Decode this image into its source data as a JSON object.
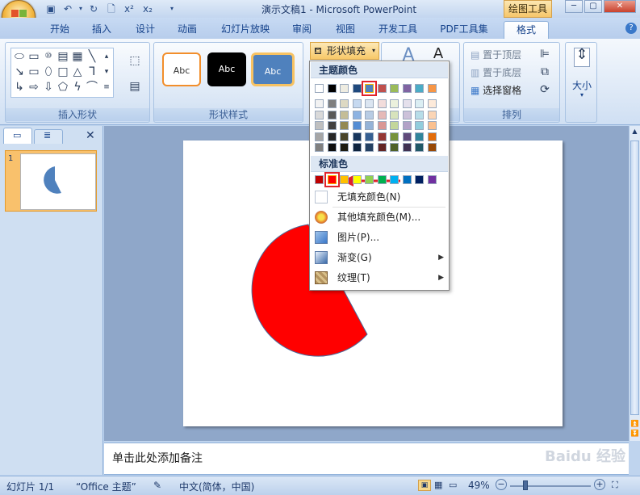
{
  "window": {
    "title": "演示文稿1 - Microsoft PowerPoint",
    "context_tab": "绘图工具"
  },
  "tabs": [
    "开始",
    "插入",
    "设计",
    "动画",
    "幻灯片放映",
    "审阅",
    "视图",
    "开发工具",
    "PDF工具集",
    "格式"
  ],
  "ribbon": {
    "groups": {
      "insert_shapes": "插入形状",
      "shape_styles": "形状样式",
      "arrange": "排列",
      "size": "大小"
    },
    "style_samples": [
      "Abc",
      "Abc",
      "Abc"
    ],
    "shape_fill_button": "形状填充",
    "arrange_commands": [
      "置于顶层",
      "置于底层",
      "选择窗格"
    ]
  },
  "fill_menu": {
    "theme_colors_label": "主题颜色",
    "standard_colors_label": "标准色",
    "items": [
      {
        "label": "无填充颜色(N)",
        "icon": "no-fill-icon",
        "has_submenu": false
      },
      {
        "label": "其他填充颜色(M)...",
        "icon": "color-palette-icon",
        "has_submenu": false
      },
      {
        "label": "图片(P)...",
        "icon": "picture-icon",
        "has_submenu": false
      },
      {
        "label": "渐变(G)",
        "icon": "gradient-icon",
        "has_submenu": true
      },
      {
        "label": "纹理(T)",
        "icon": "texture-icon",
        "has_submenu": true
      }
    ],
    "theme_top_row": [
      "#ffffff",
      "#000000",
      "#eeece1",
      "#1f497d",
      "#4f81bd",
      "#c0504d",
      "#9bbb59",
      "#8064a2",
      "#4bacc6",
      "#f79646"
    ],
    "theme_columns": [
      [
        "#f2f2f2",
        "#d9d9d9",
        "#bfbfbf",
        "#a6a6a6",
        "#808080"
      ],
      [
        "#7f7f7f",
        "#595959",
        "#404040",
        "#262626",
        "#0d0d0d"
      ],
      [
        "#ddd9c3",
        "#c4bd97",
        "#938953",
        "#494429",
        "#1d1b10"
      ],
      [
        "#c6d9f0",
        "#8db3e2",
        "#548dd4",
        "#17365d",
        "#0f243e"
      ],
      [
        "#dbe5f1",
        "#b8cce4",
        "#95b3d7",
        "#366092",
        "#244061"
      ],
      [
        "#f2dcdb",
        "#e5b9b7",
        "#d99694",
        "#953734",
        "#632423"
      ],
      [
        "#ebf1dd",
        "#d7e3bc",
        "#c3d69b",
        "#76923c",
        "#4f6128"
      ],
      [
        "#e5e0ec",
        "#ccc1d9",
        "#b2a2c7",
        "#5f497a",
        "#3f3151"
      ],
      [
        "#dbeef3",
        "#b7dde8",
        "#92cddc",
        "#31859b",
        "#205867"
      ],
      [
        "#fdeada",
        "#fbd5b5",
        "#fac08f",
        "#e36c09",
        "#974806"
      ]
    ],
    "standard_colors": [
      "#c00000",
      "#ff0000",
      "#ffc000",
      "#ffff00",
      "#92d050",
      "#00b050",
      "#00b0f0",
      "#0070c0",
      "#002060",
      "#7030a0"
    ],
    "selected_standard_index": 1
  },
  "left_pane": {
    "slide_number": "1"
  },
  "slide": {
    "shape_color": "#ff0000",
    "thumb_shape_color": "#4f81bd"
  },
  "notes": {
    "placeholder": "单击此处添加备注"
  },
  "status_bar": {
    "slide_info": "幻灯片 1/1",
    "theme": "“Office 主题”",
    "language": "中文(简体，中国)",
    "zoom": "49%"
  },
  "watermark": "Baidu 经验"
}
